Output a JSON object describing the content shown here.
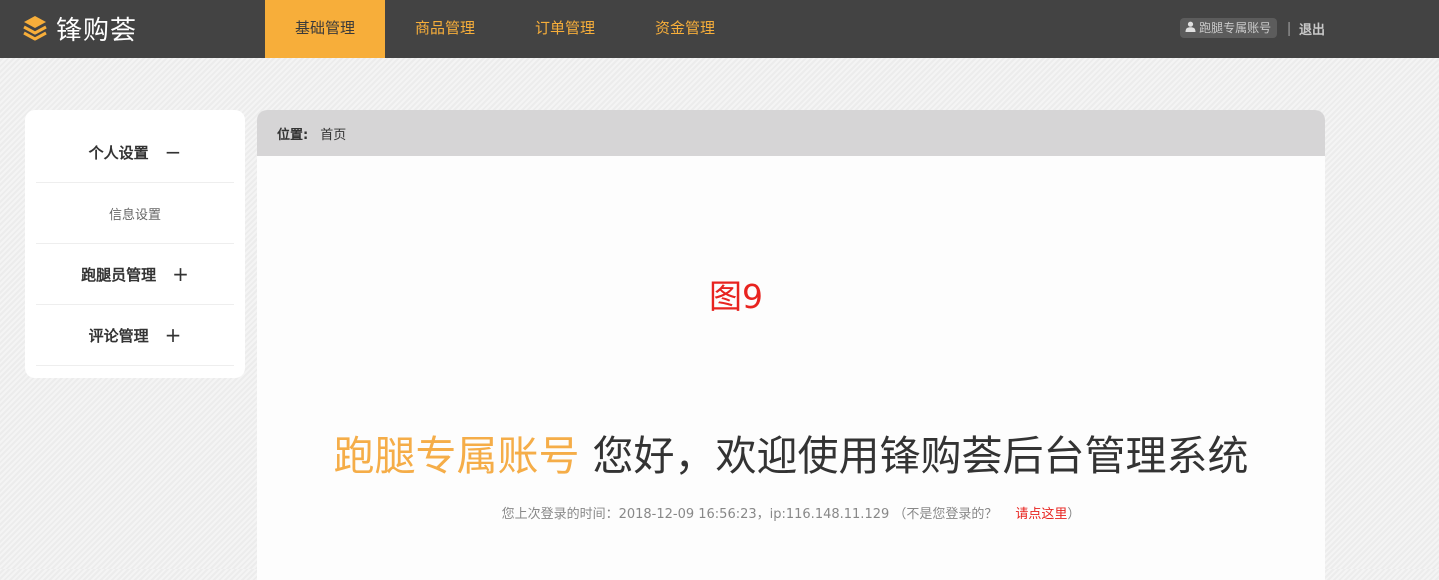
{
  "app": {
    "name": "锋购荟"
  },
  "nav": {
    "items": [
      {
        "label": "基础管理",
        "active": true
      },
      {
        "label": "商品管理",
        "active": false
      },
      {
        "label": "订单管理",
        "active": false
      },
      {
        "label": "资金管理",
        "active": false
      }
    ]
  },
  "user": {
    "account": "跑腿专属账号",
    "logout": "退出"
  },
  "sidebar": {
    "items": [
      {
        "label": "个人设置",
        "toggle": "−"
      },
      {
        "label": "信息设置"
      },
      {
        "label": "跑腿员管理",
        "toggle": "+"
      },
      {
        "label": "评论管理",
        "toggle": "+"
      }
    ]
  },
  "breadcrumb": {
    "label": "位置:",
    "current": "首页"
  },
  "figure_label": "图9",
  "welcome": {
    "account": "跑腿专属账号",
    "text": " 您好，欢迎使用锋购荟后台管理系统"
  },
  "last_login": {
    "text": "您上次登录的时间：2018-12-09 16:56:23，ip:116.148.11.129 （不是您登录的？",
    "link": "请点这里",
    "close": "）"
  },
  "colors": {
    "accent": "#f7ae3a",
    "topbar": "#434343",
    "alert": "#e8231f"
  }
}
